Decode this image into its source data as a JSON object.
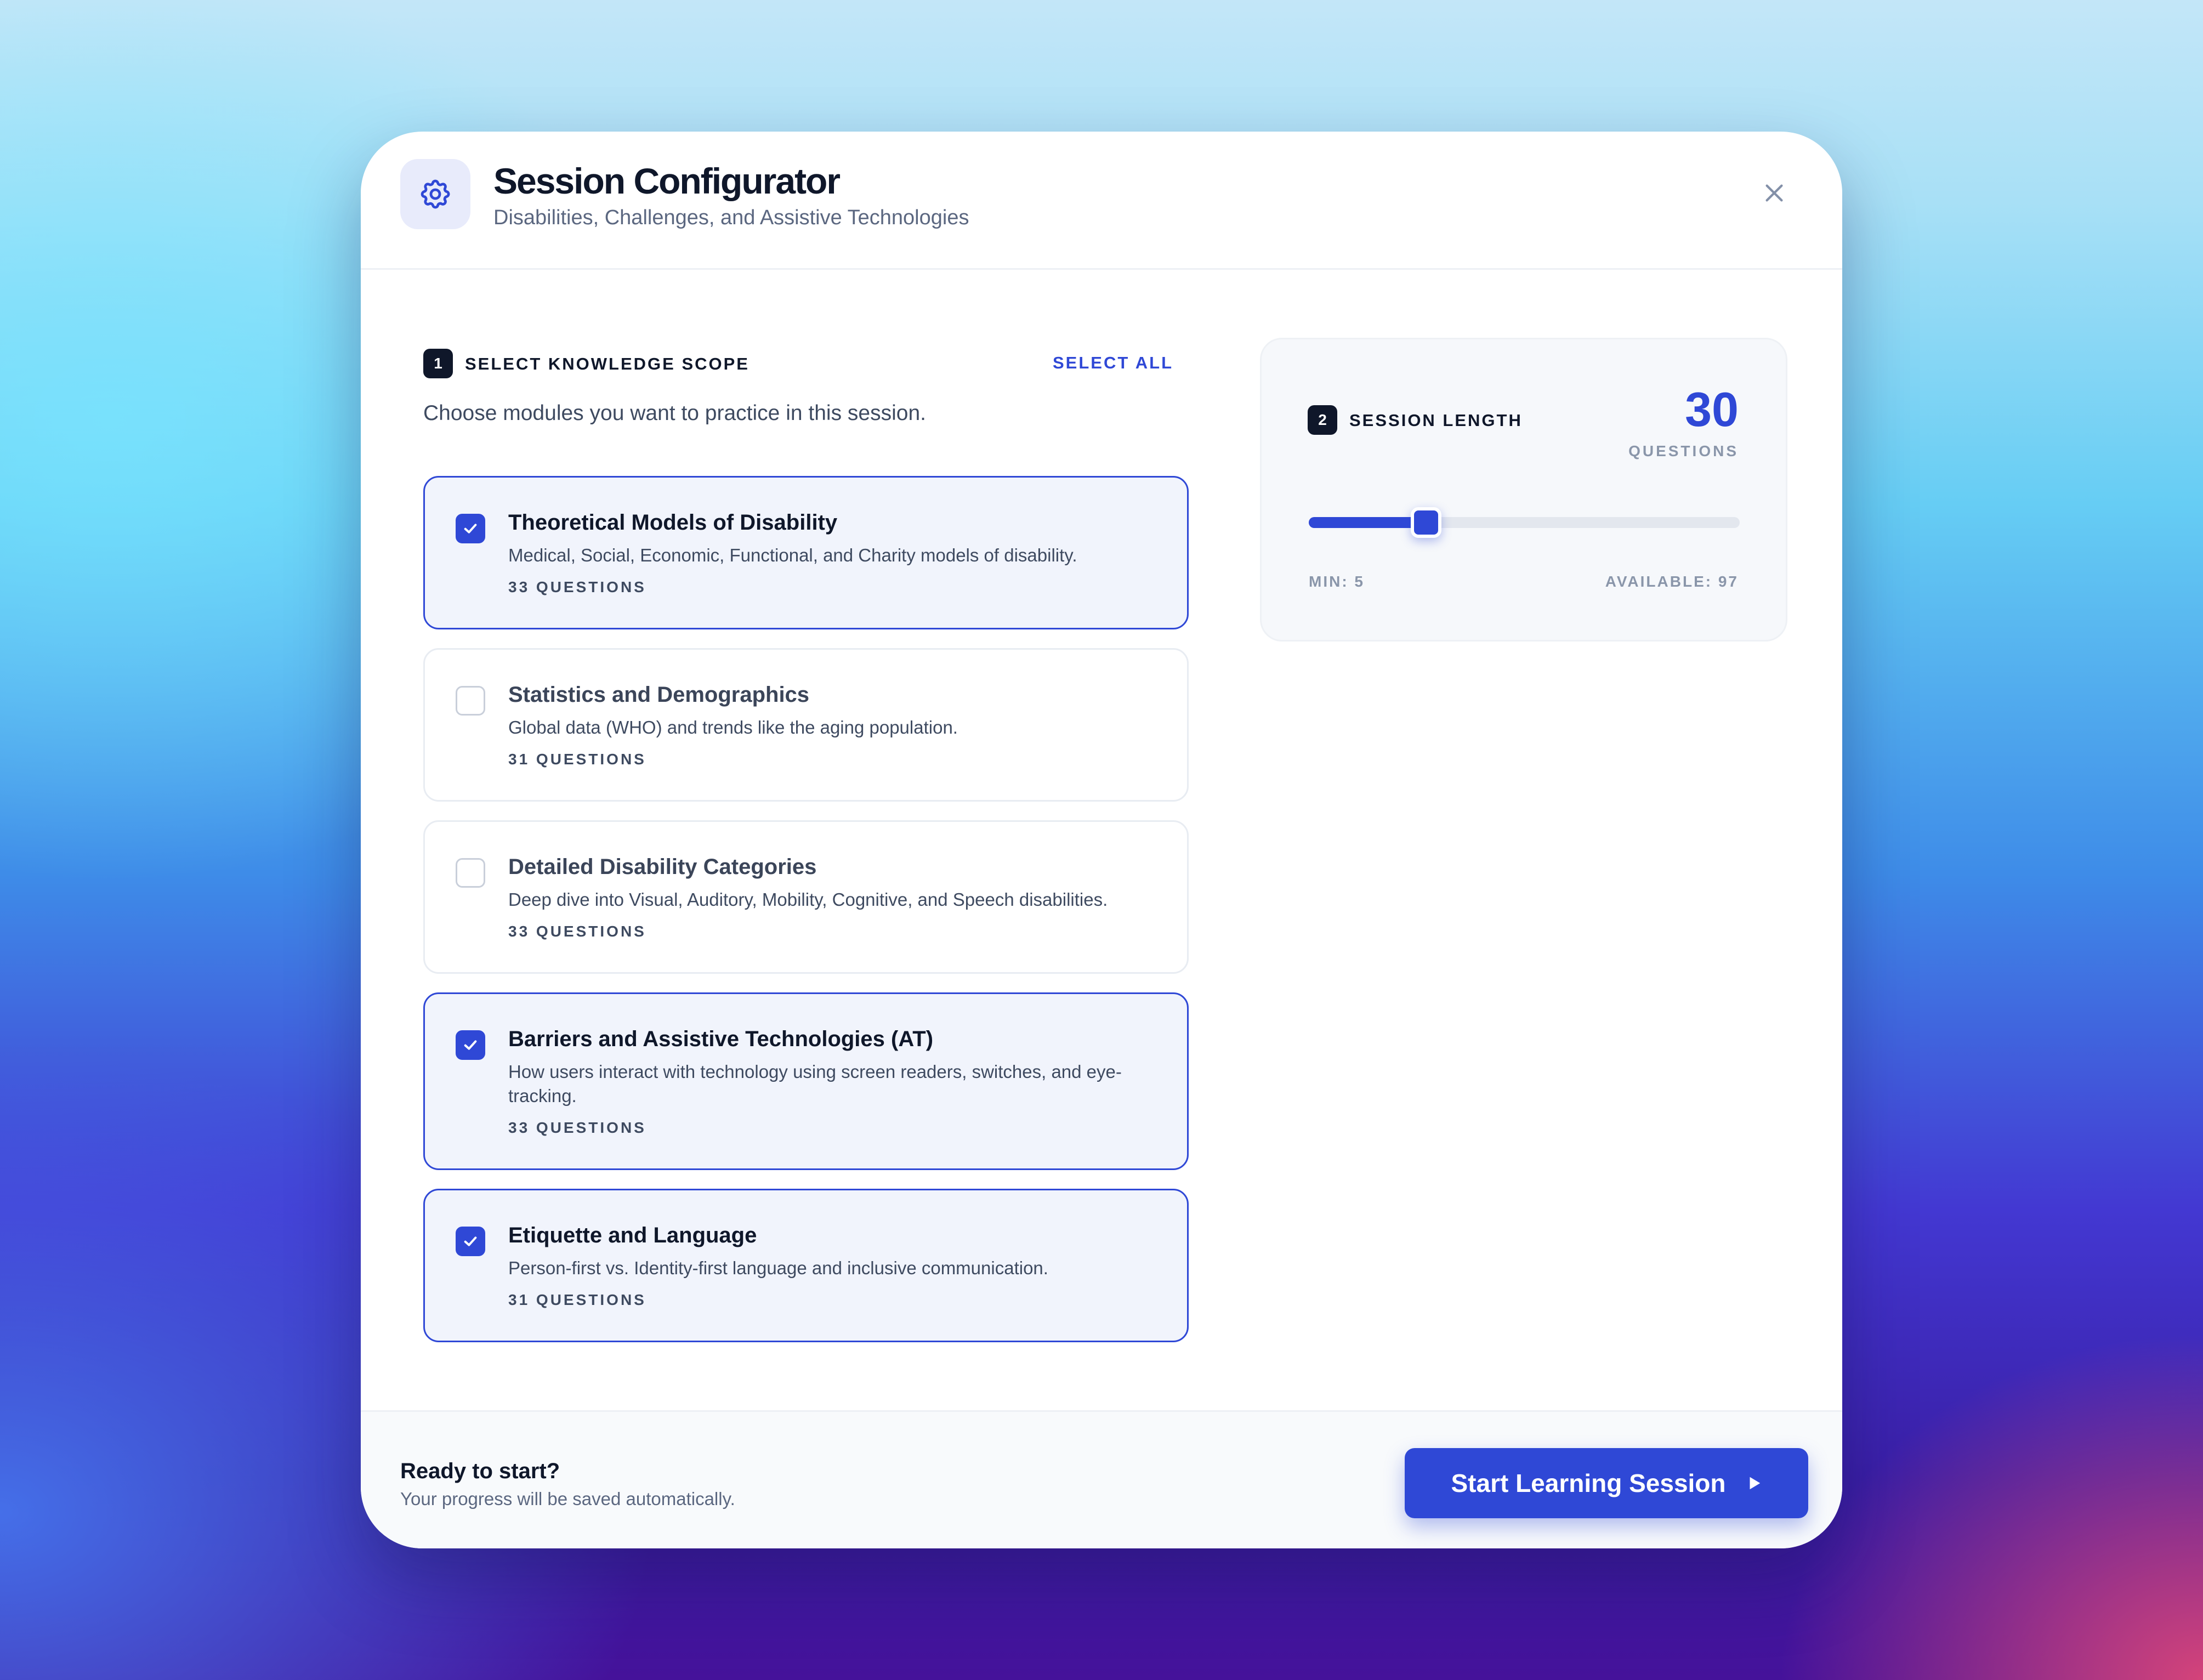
{
  "header": {
    "title": "Session Configurator",
    "subtitle": "Disabilities, Challenges, and Assistive Technologies",
    "icon": "gear-icon",
    "close_icon": "close-icon"
  },
  "scope": {
    "step": "1",
    "label": "SELECT KNOWLEDGE SCOPE",
    "select_all": "SELECT ALL",
    "description": "Choose modules you want to practice in this session.",
    "modules": [
      {
        "title": "Theoretical Models of Disability",
        "description": "Medical, Social, Economic, Functional, and Charity models of disability.",
        "count": "33 QUESTIONS",
        "checked": true
      },
      {
        "title": "Statistics and Demographics",
        "description": "Global data (WHO) and trends like the aging population.",
        "count": "31 QUESTIONS",
        "checked": false
      },
      {
        "title": "Detailed Disability Categories",
        "description": "Deep dive into Visual, Auditory, Mobility, Cognitive, and Speech disabilities.",
        "count": "33 QUESTIONS",
        "checked": false
      },
      {
        "title": "Barriers and Assistive Technologies (AT)",
        "description": "How users interact with technology using screen readers, switches, and eye-tracking.",
        "count": "33 QUESTIONS",
        "checked": true
      },
      {
        "title": "Etiquette and Language",
        "description": "Person-first vs. Identity-first language and inclusive communication.",
        "count": "31 QUESTIONS",
        "checked": true
      }
    ]
  },
  "session_length": {
    "step": "2",
    "label": "SESSION LENGTH",
    "value": "30",
    "unit": "QUESTIONS",
    "min_label": "MIN: 5",
    "max_label": "AVAILABLE: 97",
    "slider": {
      "min": 5,
      "max": 97,
      "value": 30
    }
  },
  "footer": {
    "title": "Ready to start?",
    "subtitle": "Your progress will be saved automatically.",
    "start_label": "Start Learning Session",
    "start_icon": "play-icon"
  },
  "colors": {
    "accent": "#2f48d6",
    "text_dark": "#0f172a",
    "selected_bg": "#f1f4fc"
  }
}
